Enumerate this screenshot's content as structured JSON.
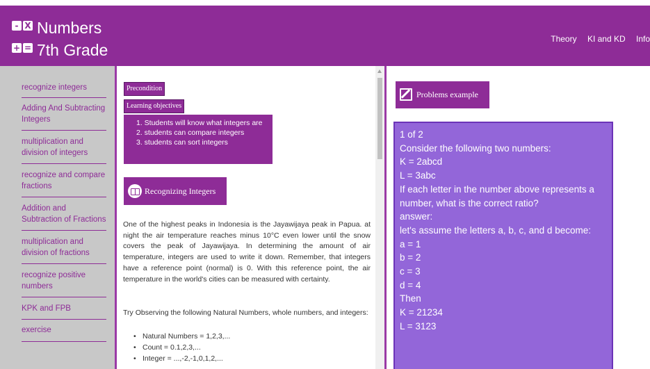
{
  "header": {
    "logo_tiles": [
      "-",
      "X",
      "+",
      "="
    ],
    "brand_line1": "Numbers",
    "brand_line2": "7th Grade",
    "nav": [
      "Theory",
      "KI and KD",
      "Info"
    ],
    "bg_color": "#8e2c97"
  },
  "sidebar": {
    "items": [
      "recognize integers",
      "Adding And Subtracting Integers",
      "multiplication and division of integers",
      "recognize and compare fractions",
      "Addition and Subtraction of Fractions",
      "multiplication and division of fractions",
      "recognize positive numbers",
      "KPK and FPB",
      "exercise"
    ]
  },
  "middle": {
    "precondition_label": "Precondition",
    "objectives_label": "Learning objectives",
    "objectives": [
      "1. Students will know what integers are",
      "2. students can compare integers",
      "3. students can sort integers"
    ],
    "section_title": "Recognizing Integers",
    "para1": "One of the highest peaks in Indonesia is the Jayawijaya peak in Papua. at night the air temperature reaches minus 10°C even lower until the snow covers the peak of Jayawijaya. In determining the amount of air temperature, integers are used to write it down. Remember, that integers have a reference point (normal) is 0. With this reference point, the air temperature in the world's cities can be measured with certainty.",
    "para2": "Try Observing the following Natural Numbers, whole numbers, and integers:",
    "bullets": [
      "Natural Numbers = 1,2,3,...",
      "Count = 0.1,2,3,...",
      "Integer = ...,-2,-1,0,1,2,..."
    ]
  },
  "right": {
    "problems_title": "Problems example",
    "problem_lines": [
      "1 of 2",
      "Consider the following two numbers:",
      "K = 2abcd",
      "L = 3abc",
      "If each letter in the number above represents a",
      "number, what is the correct ratio?",
      "answer:",
      "let's assume the letters a, b, c, and d become:",
      "a = 1",
      "b = 2",
      "c = 3",
      "d = 4",
      "Then",
      "K = 21234",
      "L = 3123"
    ],
    "box_color": "#9366d9"
  }
}
